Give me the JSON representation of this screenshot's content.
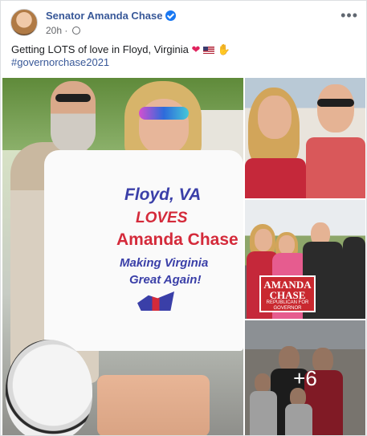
{
  "post": {
    "author": "Senator Amanda Chase",
    "timestamp": "20h",
    "privacy_icon": "globe-icon",
    "more_icon": "more-options-icon",
    "text": "Getting LOTS of love in Floyd, Virginia",
    "emojis": [
      "❤️",
      "🇺🇸",
      "🙏"
    ],
    "hashtag": "#governorchase2021"
  },
  "photos": {
    "main": {
      "shirt_lines": [
        "Floyd, VA",
        "LOVES",
        "Amanda Chase",
        "Making Virginia",
        "Great Again!"
      ]
    },
    "sign": {
      "name_line1": "AMANDA",
      "name_line2": "CHASE",
      "subline": "REPUBLICAN FOR GOVERNOR"
    },
    "more_count": "+6"
  },
  "colors": {
    "link": "#385898",
    "verified": "#1877f2",
    "shirt_blue": "#3a3fa8",
    "shirt_red": "#d42a3a"
  }
}
